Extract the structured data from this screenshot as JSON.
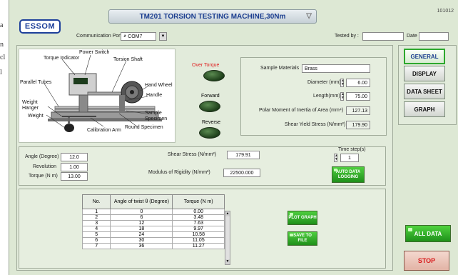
{
  "margin_marks": [
    "a",
    "n",
    "cl",
    "l"
  ],
  "window": {
    "id": "101012",
    "logo": "ESSOM",
    "title": "TM201 TORSION TESTING MACHINE,30Nm"
  },
  "comm": {
    "label": "Communication Port",
    "port_value": "COM7",
    "tested_by_label": "Tested by :",
    "tested_by_value": "",
    "date_label": "Date",
    "date_value": ""
  },
  "diagram_labels": {
    "power_switch": "Power Switch",
    "torque_indicator": "Torque Indicator",
    "torsion_shaft": "Torsion Shaft",
    "parallel_tubes": "Parallel Tubes",
    "hand_wheel": "Hand Wheel",
    "handle": "Handle",
    "weight_hanger": "Weight\nHanger",
    "weight": "Weight",
    "sample_specimen": "Sample\nSpecimen",
    "calibration_arm": "Calibration Arm",
    "round_specimen": "Round Specimen"
  },
  "indicators": {
    "over_torque": "Over Torque",
    "forward": "Forward",
    "reverse": "Reverse"
  },
  "sample": {
    "materials_label": "Sample Materials",
    "materials_value": "Brass",
    "diameter_label": "Diameter (mm)",
    "diameter_value": "6.00",
    "length_label": "Length(mm)",
    "length_value": "75.00",
    "polar_label": "Polar Moment of Inertia of Area (mm⁴)",
    "polar_value": "127.13",
    "shear_yield_label": "Shear Yield Stress (N/mm²)",
    "shear_yield_value": "179.90"
  },
  "readings": {
    "angle_label": "Angle (Degree)",
    "angle_value": "12.0",
    "revolution_label": "Revolution",
    "revolution_value": "1.00",
    "torque_label": "Torque (N m)",
    "torque_value": "13.00",
    "shear_stress_label": "Shear Stress (N/mm²)",
    "shear_stress_value": "179.91",
    "modulus_label": "Modulus of Rigidity (N/mm²)",
    "modulus_value": "22500.000",
    "time_step_label": "Time step(s)",
    "time_step_value": "1",
    "auto_logging": "AUTO DATA\nLOGGING"
  },
  "table": {
    "headers": [
      "No.",
      "Angle of twist θ  (Degree)",
      "Torque (N m)"
    ],
    "rows": [
      [
        "1",
        "0",
        "0.00"
      ],
      [
        "2",
        "6",
        "3.48"
      ],
      [
        "3",
        "12",
        "7.63"
      ],
      [
        "4",
        "18",
        "9.97"
      ],
      [
        "5",
        "24",
        "10.58"
      ],
      [
        "6",
        "30",
        "11.05"
      ],
      [
        "7",
        "36",
        "11.27"
      ]
    ]
  },
  "actions": {
    "plot_graph": "PLOT GRAPH",
    "save_to_file": "SAVE TO FILE",
    "all_data": "ALL DATA",
    "stop": "STOP"
  },
  "nav": {
    "general": "GENERAL",
    "display": "DISPLAY",
    "data_sheet": "DATA SHEET",
    "graph": "GRAPH"
  }
}
